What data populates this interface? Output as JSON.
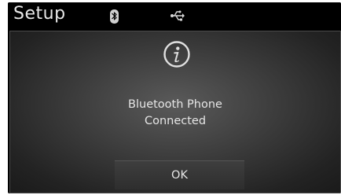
{
  "header": {
    "title": "Setup",
    "icons": [
      "bluetooth-icon",
      "usb-icon"
    ]
  },
  "dialog": {
    "icon": "info-icon",
    "message_line1": "Bluetooth Phone",
    "message_line2": "Connected",
    "ok_label": "OK"
  },
  "colors": {
    "background": "#000000",
    "text": "#e6e6e6",
    "dialog_center": "#5a5a5a",
    "dialog_edge": "#1a1a1a"
  }
}
